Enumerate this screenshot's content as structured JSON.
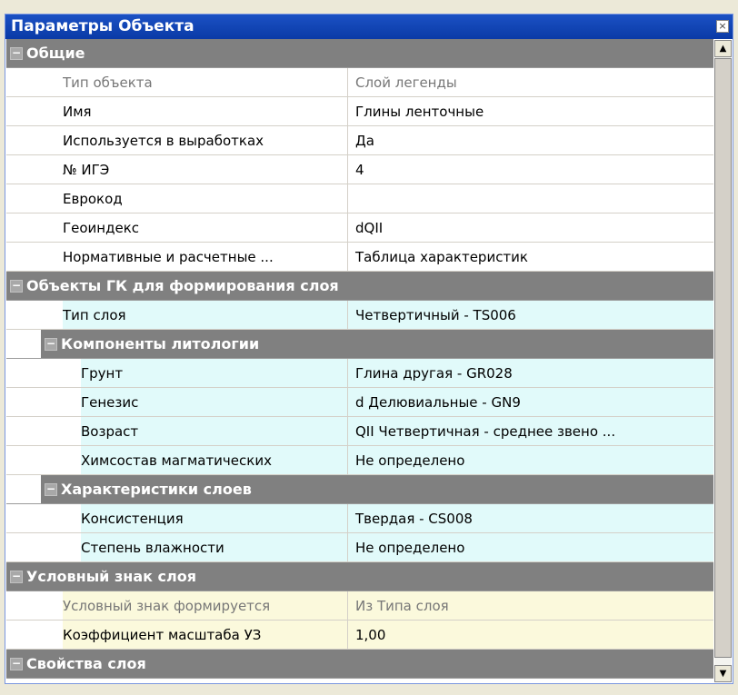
{
  "window": {
    "title": "Параметры Объекта",
    "close_glyph": "×"
  },
  "categories": {
    "general": "Общие",
    "gk_objects": "Объекты ГК для формирования слоя",
    "lithology": "Компоненты литологии",
    "layer_chars": "Характеристики слоев",
    "symbol": "Условный знак слоя",
    "layer_props": "Свойства слоя"
  },
  "toggle": "−",
  "rows": {
    "object_type": {
      "label": "Тип объекта",
      "value": "Слой легенды"
    },
    "name": {
      "label": "Имя",
      "value": "Глины ленточные"
    },
    "used": {
      "label": "Используется в выработках",
      "value": "Да"
    },
    "ige": {
      "label": "№ ИГЭ",
      "value": "4"
    },
    "eurocode": {
      "label": "Еврокод",
      "value": ""
    },
    "geoindex": {
      "label": "Геоиндекс",
      "value": "dQII"
    },
    "normative": {
      "label": "Нормативные и расчетные ...",
      "value": "Таблица характеристик"
    },
    "layer_type": {
      "label": "Тип слоя",
      "value": "Четвертичный - TS006"
    },
    "soil": {
      "label": "Грунт",
      "value": "Глина другая - GR028"
    },
    "genesis": {
      "label": "Генезис",
      "value": "d Делювиальные - GN9"
    },
    "age": {
      "label": "Возраст",
      "value": "QII Четвертичная - среднее звено ..."
    },
    "chem": {
      "label": "Химсостав магматических",
      "value": "Не определено"
    },
    "consistency": {
      "label": "Консистенция",
      "value": "Твердая - CS008"
    },
    "moisture": {
      "label": "Степень влажности",
      "value": "Не определено"
    },
    "symbol_formed": {
      "label": "Условный знак формируется",
      "value": "Из Типа слоя"
    },
    "scale_coef": {
      "label": "Коэффициент масштаба УЗ",
      "value": "1,00"
    }
  },
  "scrollbar": {
    "up": "▲",
    "down": "▼"
  }
}
